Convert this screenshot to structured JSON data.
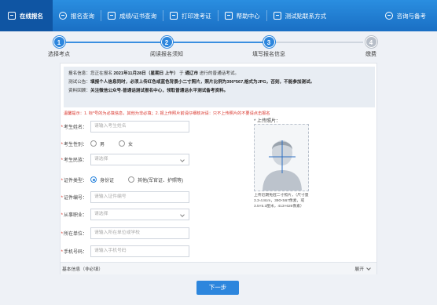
{
  "nav": {
    "items": [
      {
        "label": "在线报名",
        "icon": "edit-icon",
        "active": true
      },
      {
        "label": "报名查询",
        "icon": "search-icon"
      },
      {
        "label": "成绩/证书查询",
        "icon": "certificate-icon"
      },
      {
        "label": "打印准考证",
        "icon": "printer-icon"
      },
      {
        "label": "帮助中心",
        "icon": "help-icon"
      },
      {
        "label": "测试贴联系方式",
        "icon": "contact-icon"
      }
    ],
    "right_label": "咨询与备考",
    "colors": {
      "bar": "#1a6fc4",
      "active": "#0f55a3"
    }
  },
  "steps": [
    {
      "num": "1",
      "label": "选择考点",
      "done": true
    },
    {
      "num": "2",
      "label": "阅读报名须知",
      "done": true
    },
    {
      "num": "3",
      "label": "填写报名信息",
      "done": true
    },
    {
      "num": "4",
      "label": "缴费",
      "done": false
    }
  ],
  "info": {
    "line1_prefix": "报名信息：您正在报名",
    "line1_date": "2021年11月28日（星期日 上午）",
    "line1_mid": "于",
    "line1_place": "通辽市",
    "line1_suffix": "进行的普通话考试。",
    "line2_label": "测试公告：",
    "line2_text": "填报个人信息同时，必须上传红色或蓝色背景小二寸照片，照片比例为390*567,格式为JPG，否则，不能参加测试。",
    "line3_label": "资料回顾：",
    "line3_text": "关注微信公众号-普通话测试报名中心，领取普通话水平测试备考资料。"
  },
  "tip": "温馨提示：1. 标*号的为必填信息，其他为非必填；2. 报上传照片前请仔细核对请：只不上传照片的不要请点击报名",
  "form": {
    "name": {
      "label": "考生姓名：",
      "placeholder": "请输入考生姓名"
    },
    "gender": {
      "label": "考生性别：",
      "options": [
        "男",
        "女"
      ]
    },
    "ethnic": {
      "label": "考生民族：",
      "value": "请选择"
    },
    "idtype": {
      "label": "证件类型：",
      "options": [
        "身份证",
        "其他(军官证、护照等)"
      ]
    },
    "idnum": {
      "label": "证件编号：",
      "placeholder": "请输入证件编号"
    },
    "job": {
      "label": "从事职业：",
      "value": "请选择"
    },
    "unit": {
      "label": "所在单位：",
      "placeholder": "请输入所在单位或学校"
    },
    "phone": {
      "label": "手机号码：",
      "placeholder": "请输入手机号码"
    }
  },
  "photo": {
    "label": "* 上传照片：",
    "note": "上传近期免冠二寸照片，（尺寸量3.3-4.8cm，390×567像素，或3.5×5.3厘米，413×626像素）"
  },
  "bottom": {
    "label": "基本信息（非必填）",
    "expand": "展开"
  },
  "next_button": "下一步"
}
